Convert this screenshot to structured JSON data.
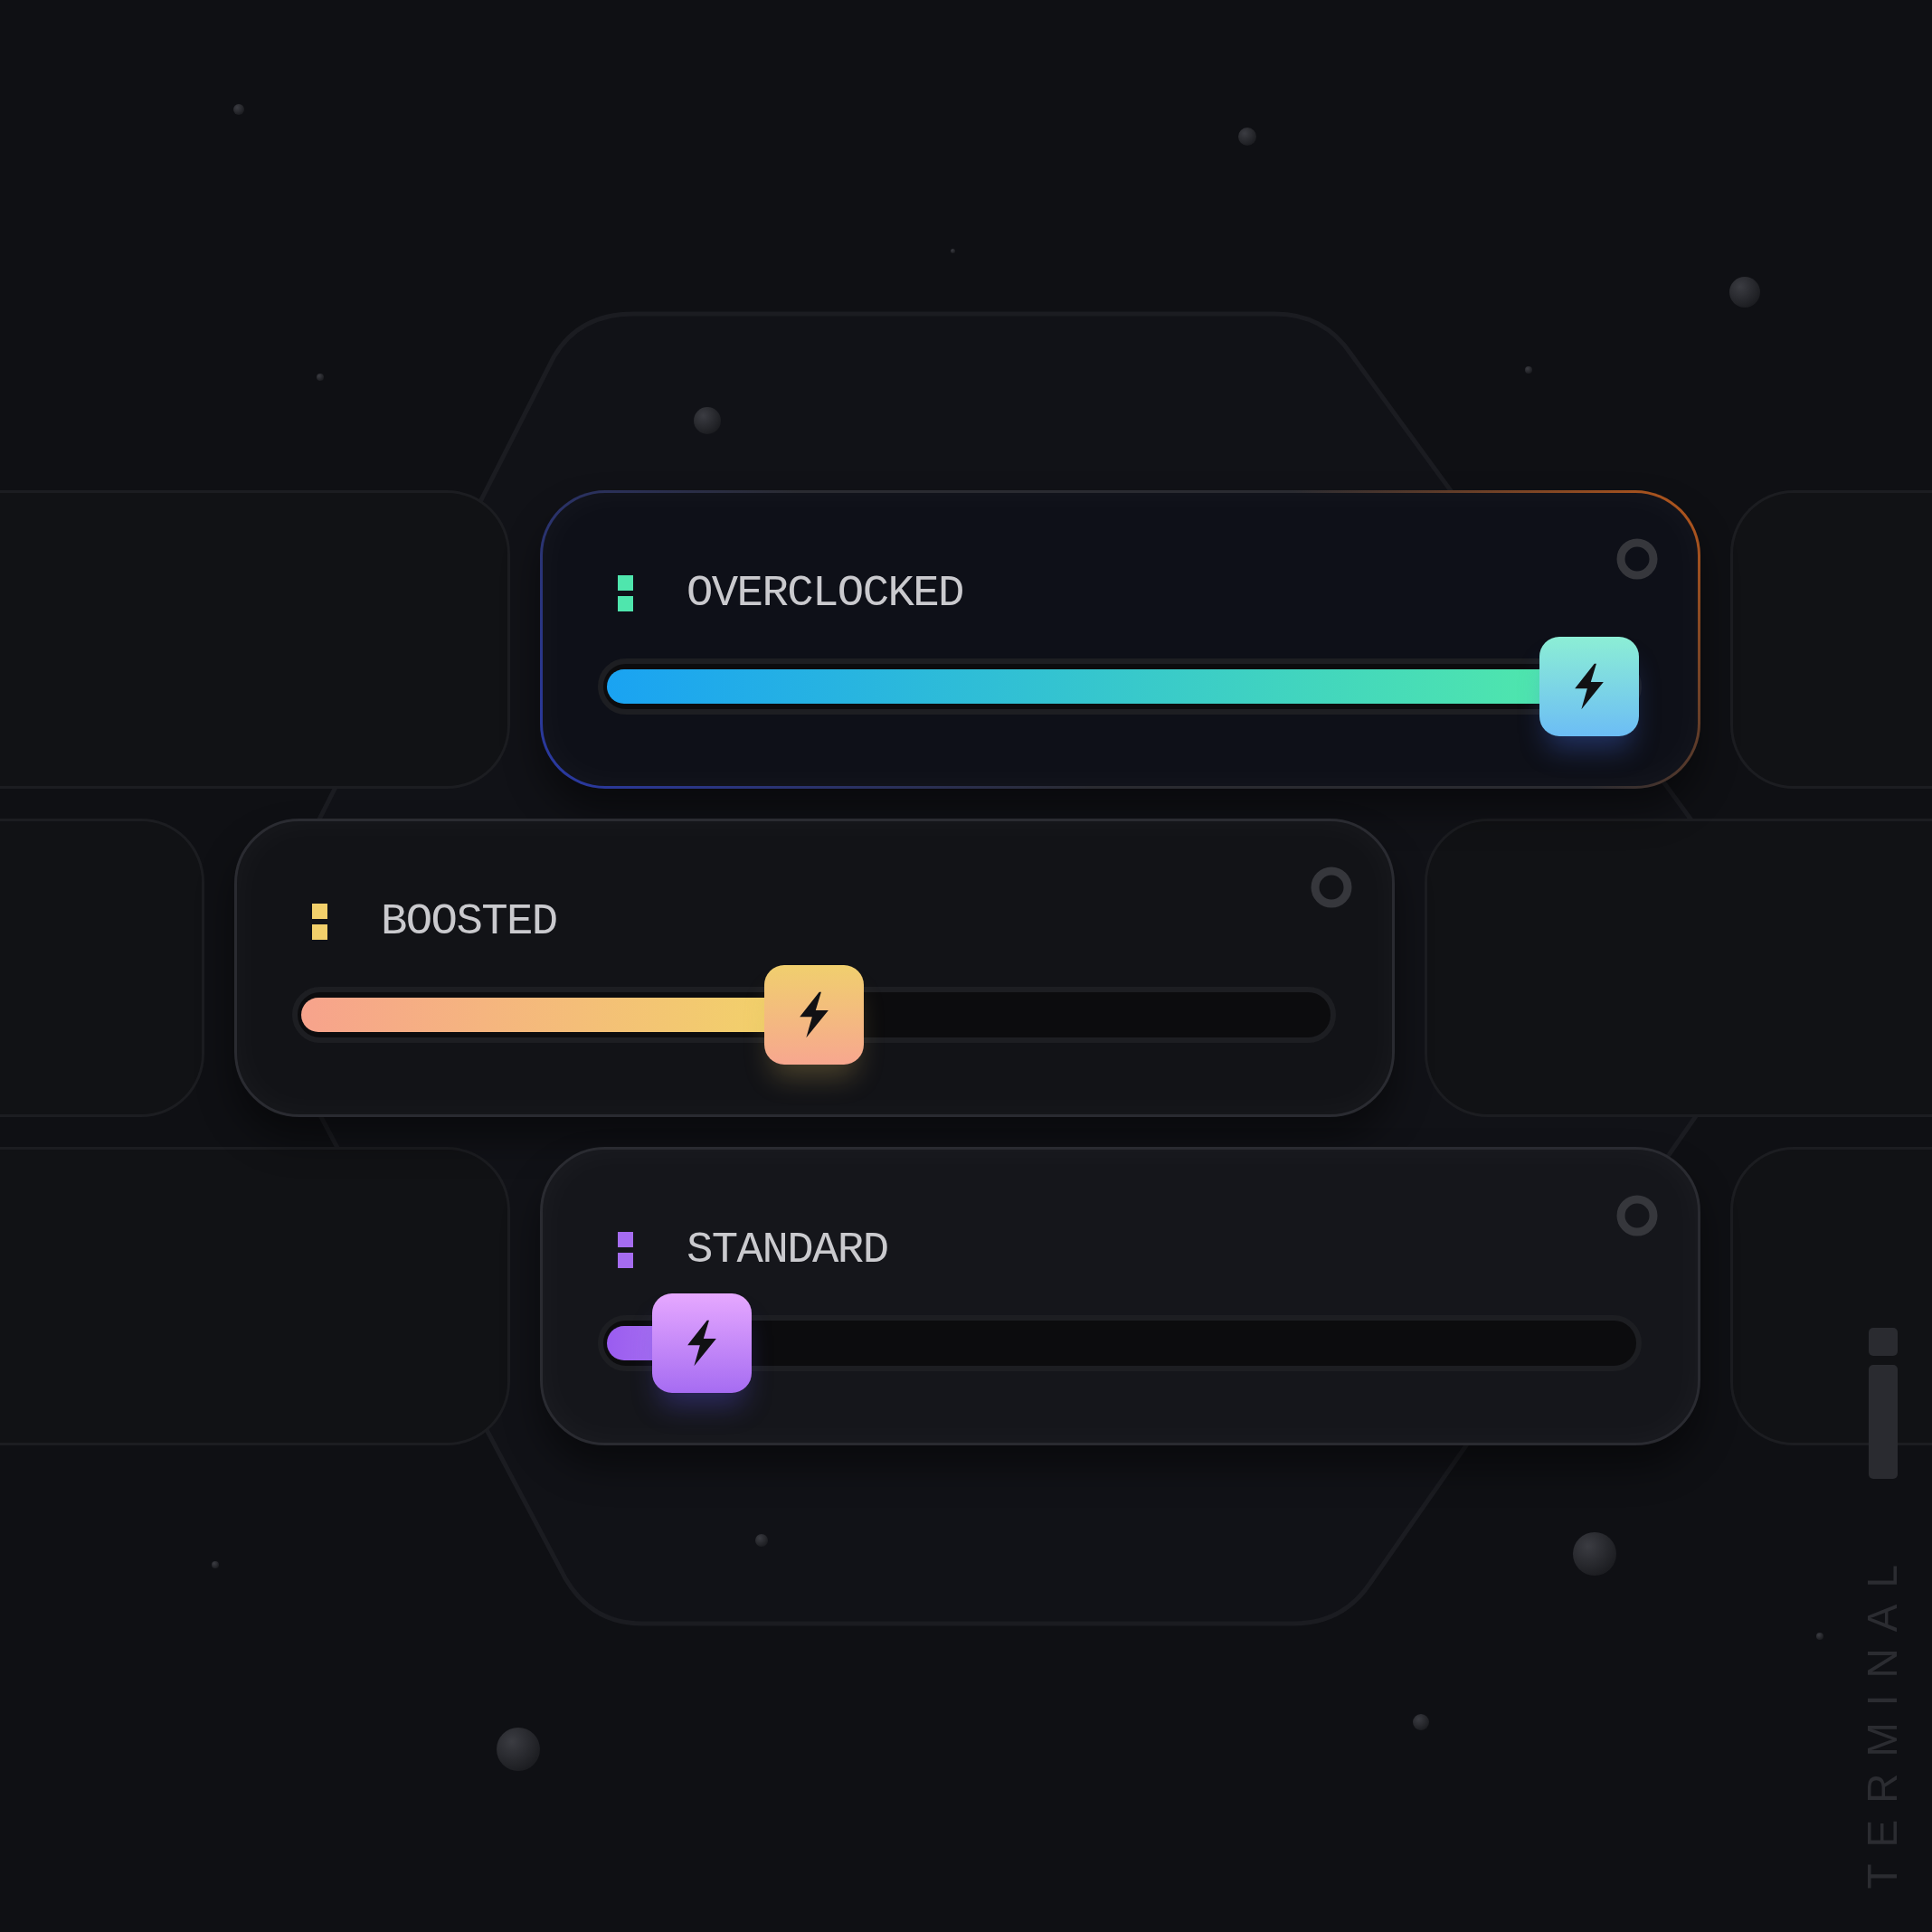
{
  "sliders": [
    {
      "label": "OVERCLOCKED",
      "color": "#4fe6ad",
      "level": 0.95,
      "selected": true
    },
    {
      "label": "BOOSTED",
      "color": "#f2d06b",
      "level": 0.5,
      "selected": false
    },
    {
      "label": "STANDARD",
      "color": "#a56cf0",
      "level": 0.1,
      "selected": false
    }
  ],
  "brand": {
    "name": "TERMINAL"
  }
}
